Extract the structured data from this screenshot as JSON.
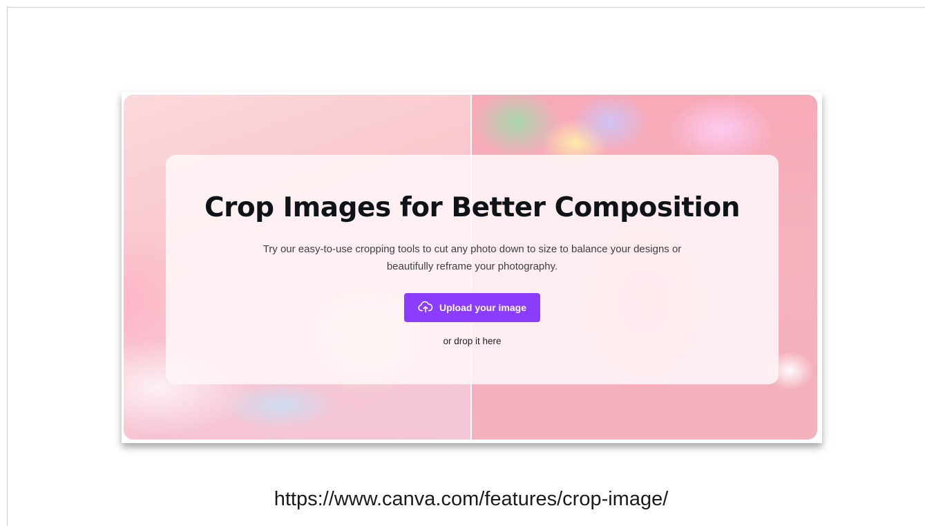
{
  "hero": {
    "headline": "Crop Images for Better Composition",
    "subtext_line1": "Try our easy-to-use cropping tools to cut any photo down to size to balance your designs or",
    "subtext_line2": "beautifully reframe your photography.",
    "upload_button": {
      "label": "Upload your image",
      "icon": "cloud-upload-icon",
      "color": "#8b3dff"
    },
    "drop_text": "or drop it here"
  },
  "caption": {
    "url": "https://www.canva.com/features/crop-image/"
  }
}
